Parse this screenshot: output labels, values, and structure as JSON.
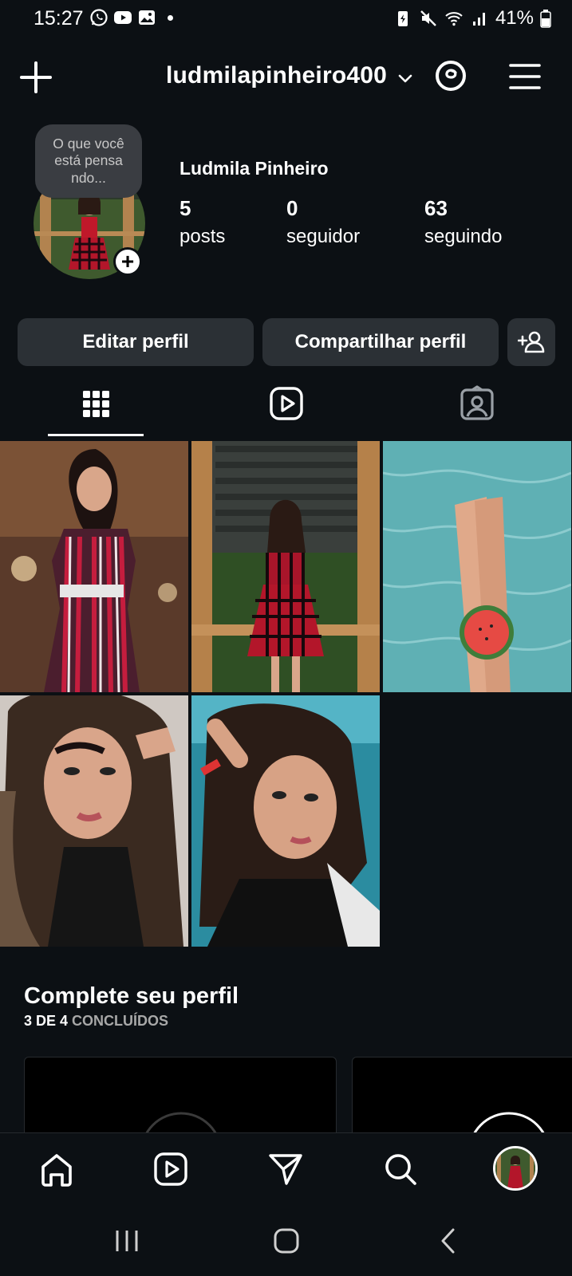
{
  "status_bar": {
    "time": "15:27",
    "battery": "41%"
  },
  "header": {
    "username": "ludmilapinheiro400"
  },
  "profile": {
    "note": "O que você está pensa ndo...",
    "display_name": "Ludmila Pinheiro",
    "stats": [
      {
        "value": "5",
        "label": "posts"
      },
      {
        "value": "0",
        "label": "seguidor"
      },
      {
        "value": "63",
        "label": "seguindo"
      }
    ]
  },
  "actions": {
    "edit_label": "Editar perfil",
    "share_label": "Compartilhar perfil"
  },
  "tabs": [
    "grid-icon",
    "reels-icon",
    "tagged-icon"
  ],
  "posts": [
    {
      "subject": "woman in striped dress"
    },
    {
      "subject": "woman in plaid dress on balcony"
    },
    {
      "subject": "legs in pool with watermelon"
    },
    {
      "subject": "woman portrait with long hair"
    },
    {
      "subject": "woman portrait by the sea"
    }
  ],
  "complete_profile": {
    "title": "Complete seu perfil",
    "progress_count": "3 DE 4",
    "progress_label": "CONCLUÍDOS"
  },
  "bottom_nav": [
    "home-icon",
    "reels-icon",
    "direct-icon",
    "search-icon",
    "profile-avatar"
  ],
  "system_nav": [
    "recents-icon",
    "home-icon",
    "back-icon"
  ],
  "colors": {
    "background": "#0c1014",
    "button": "#2b3035",
    "note_bubble": "#3a3d42"
  }
}
